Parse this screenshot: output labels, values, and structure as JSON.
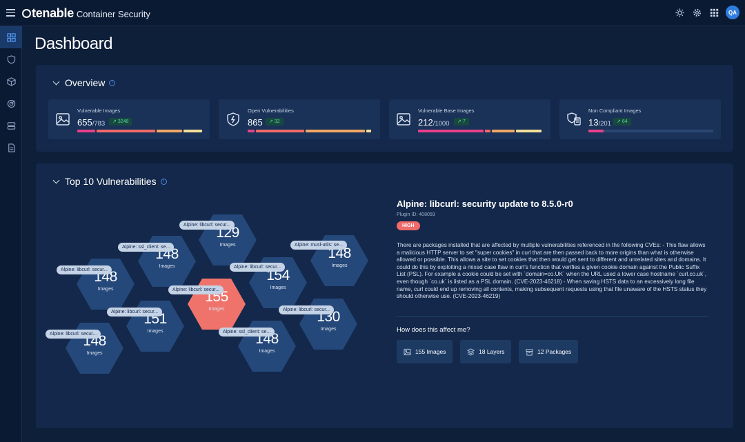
{
  "app": {
    "brand": "tenable",
    "product": "Container Security",
    "avatar": "QA"
  },
  "top_icons": [
    "sun-icon",
    "gear-icon",
    "apps-grid-icon"
  ],
  "sidebar": [
    "dashboard-icon",
    "shield-icon",
    "cube-icon",
    "radar-icon",
    "stack-icon",
    "report-icon"
  ],
  "page": {
    "title": "Dashboard"
  },
  "overview": {
    "title": "Overview",
    "cards": [
      {
        "label": "Vulnerable Images",
        "value": "655",
        "total": "/783",
        "trend": "3248",
        "icon": "image-icon"
      },
      {
        "label": "Open Vulnerabilities",
        "value": "865",
        "total": "",
        "trend": "32",
        "icon": "shield-bolt-icon"
      },
      {
        "label": "Vulnerable Base Images",
        "value": "212",
        "total": "/1000",
        "trend": "7",
        "icon": "image-icon"
      },
      {
        "label": "Non Compliant Images",
        "value": "13",
        "total": "/201",
        "trend": "64",
        "icon": "compliance-icon"
      }
    ]
  },
  "top10": {
    "title": "Top 10 Vulnerabilities",
    "images_word": "Images",
    "hexes": [
      {
        "tag": "Alpine: libcurl: secur...",
        "count": "129"
      },
      {
        "tag": "Alpine: ssl_client: se...",
        "count": "148"
      },
      {
        "tag": "Alpine: musl-utils: se...",
        "count": "148"
      },
      {
        "tag": "Alpine: libcurl: secur...",
        "count": "148"
      },
      {
        "tag": "Alpine: libcurl: secur...",
        "count": "154"
      },
      {
        "tag": "Alpine: libcurl: secur...",
        "count": "155"
      },
      {
        "tag": "Alpine: libcurl: secur...",
        "count": "151"
      },
      {
        "tag": "Alpine: libcurl: secur...",
        "count": "130"
      },
      {
        "tag": "Alpine: libcurl: secur...",
        "count": "148"
      },
      {
        "tag": "Alpine: ssl_client: se...",
        "count": "148"
      }
    ]
  },
  "detail": {
    "title": "Alpine: libcurl: security update to 8.5.0-r0",
    "plugin": "Plugin ID: 408059",
    "severity": "HIGH",
    "description": "There are packages installed that are affected by multiple vulnerabilities referenced in the following CVEs: - This flaw allows a malicious HTTP server to set \"super cookies\" in curl that are then passed back to more origins than what is otherwise allowed or possible. This allows a site to set cookies that then would get sent to different and unrelated sites and domains. It could do this by exploiting a mixed case flaw in curl's function that verifies a given cookie domain against the Public Suffix List (PSL). For example a cookie could be set with `domain=co.UK` when the URL used a lower case hostname `curl.co.uk`, even though `co.uk` is listed as a PSL domain. (CVE-2023-46218) - When saving HSTS data to an excessively long file name, curl could end up removing all contents, making subsequent requests using that file unaware of the HSTS status they should otherwise use. (CVE-2023-46219)",
    "affect_title": "How does this affect me?",
    "chips": [
      "155 Images",
      "18 Layers",
      "12 Packages"
    ]
  },
  "colors": {
    "high": "#f0736b",
    "hex": "#25487a",
    "accent": "#2f7de1"
  }
}
